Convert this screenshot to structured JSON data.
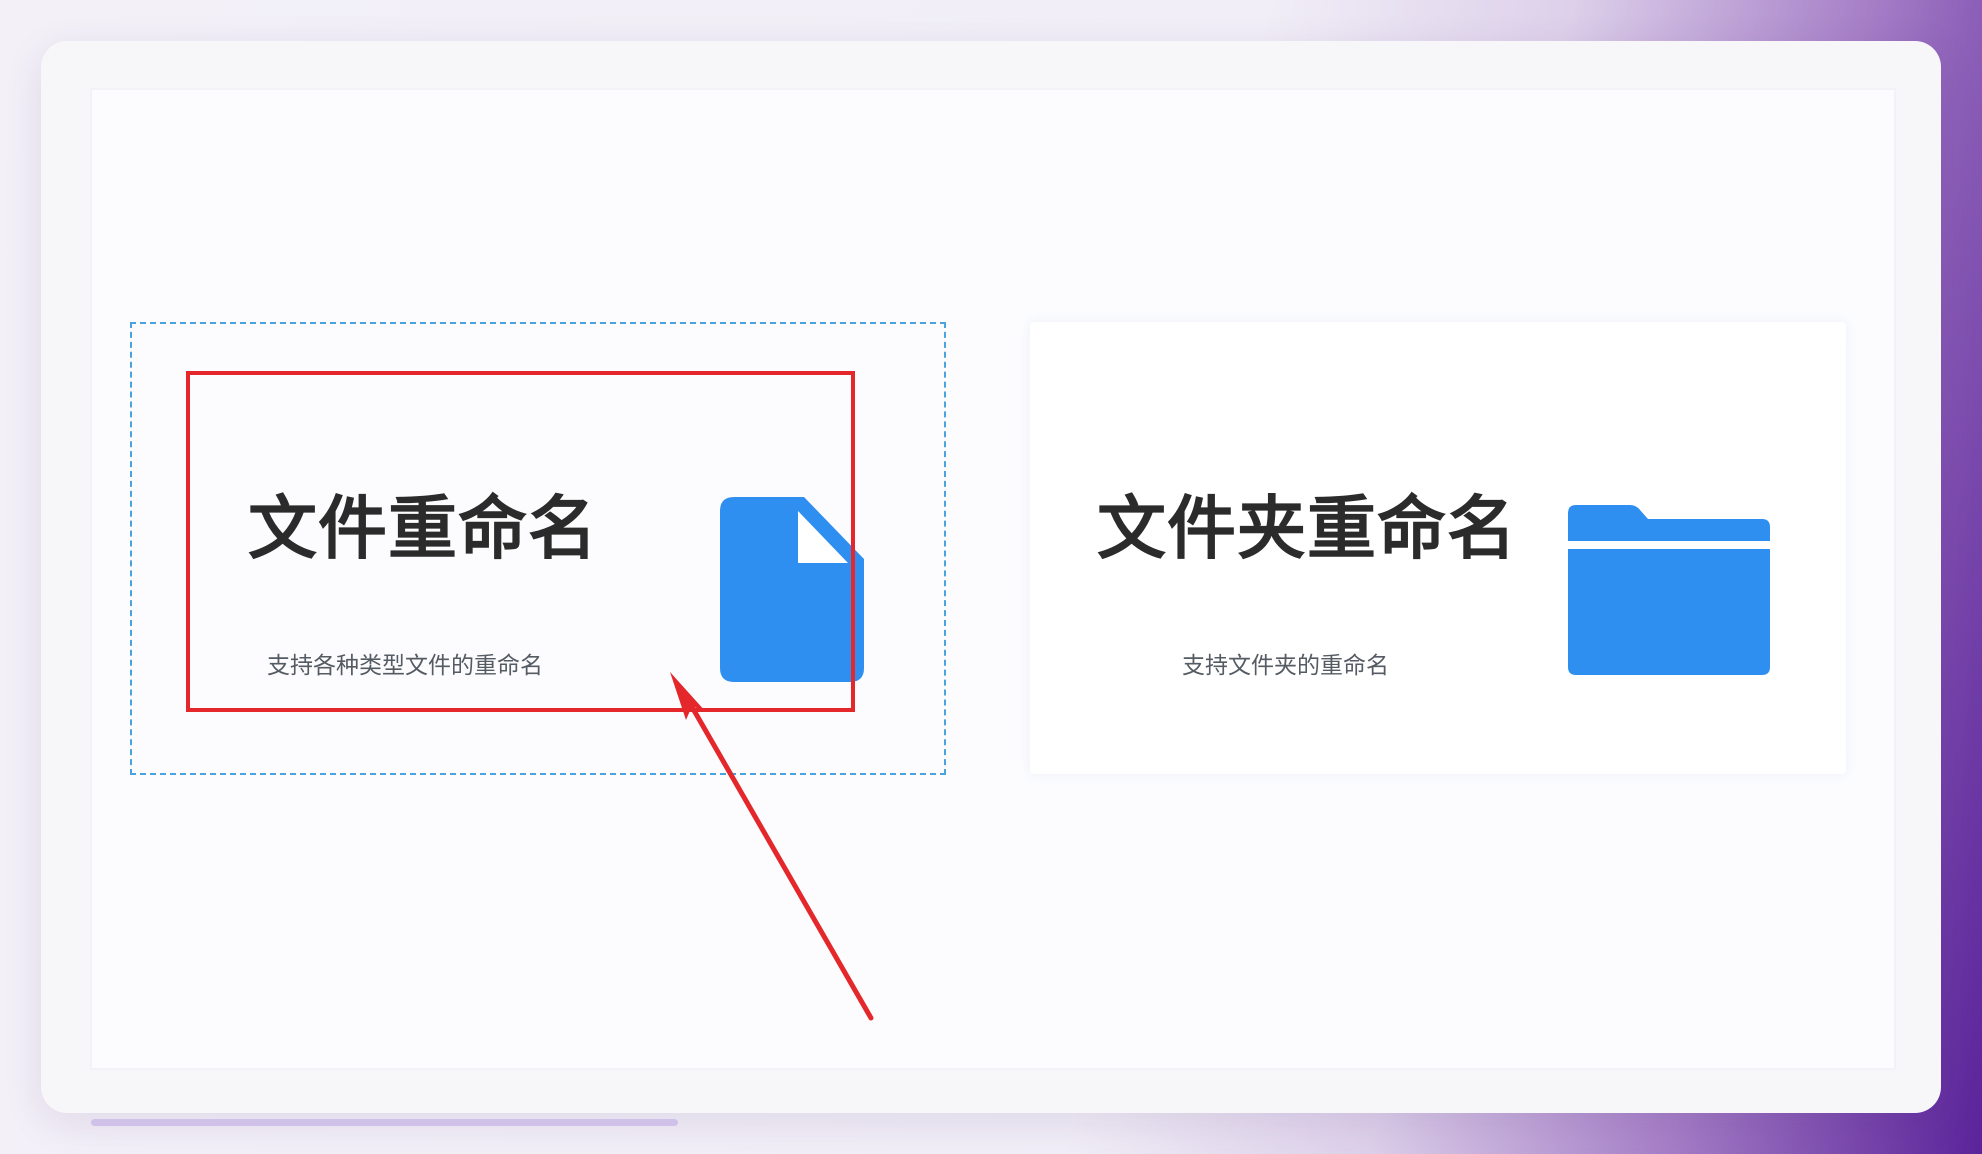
{
  "cards": [
    {
      "title": "文件重命名",
      "subtitle": "支持各种类型文件的重命名",
      "icon": "file-icon",
      "selected": true
    },
    {
      "title": "文件夹重命名",
      "subtitle": "支持文件夹的重命名",
      "icon": "folder-icon",
      "selected": false
    }
  ],
  "colors": {
    "icon_blue": "#2f8ff0",
    "highlight_red": "#e3272b",
    "selection_outline": "#4aa3dc",
    "title_text": "#2b2b2b",
    "subtitle_text": "#555b63"
  }
}
